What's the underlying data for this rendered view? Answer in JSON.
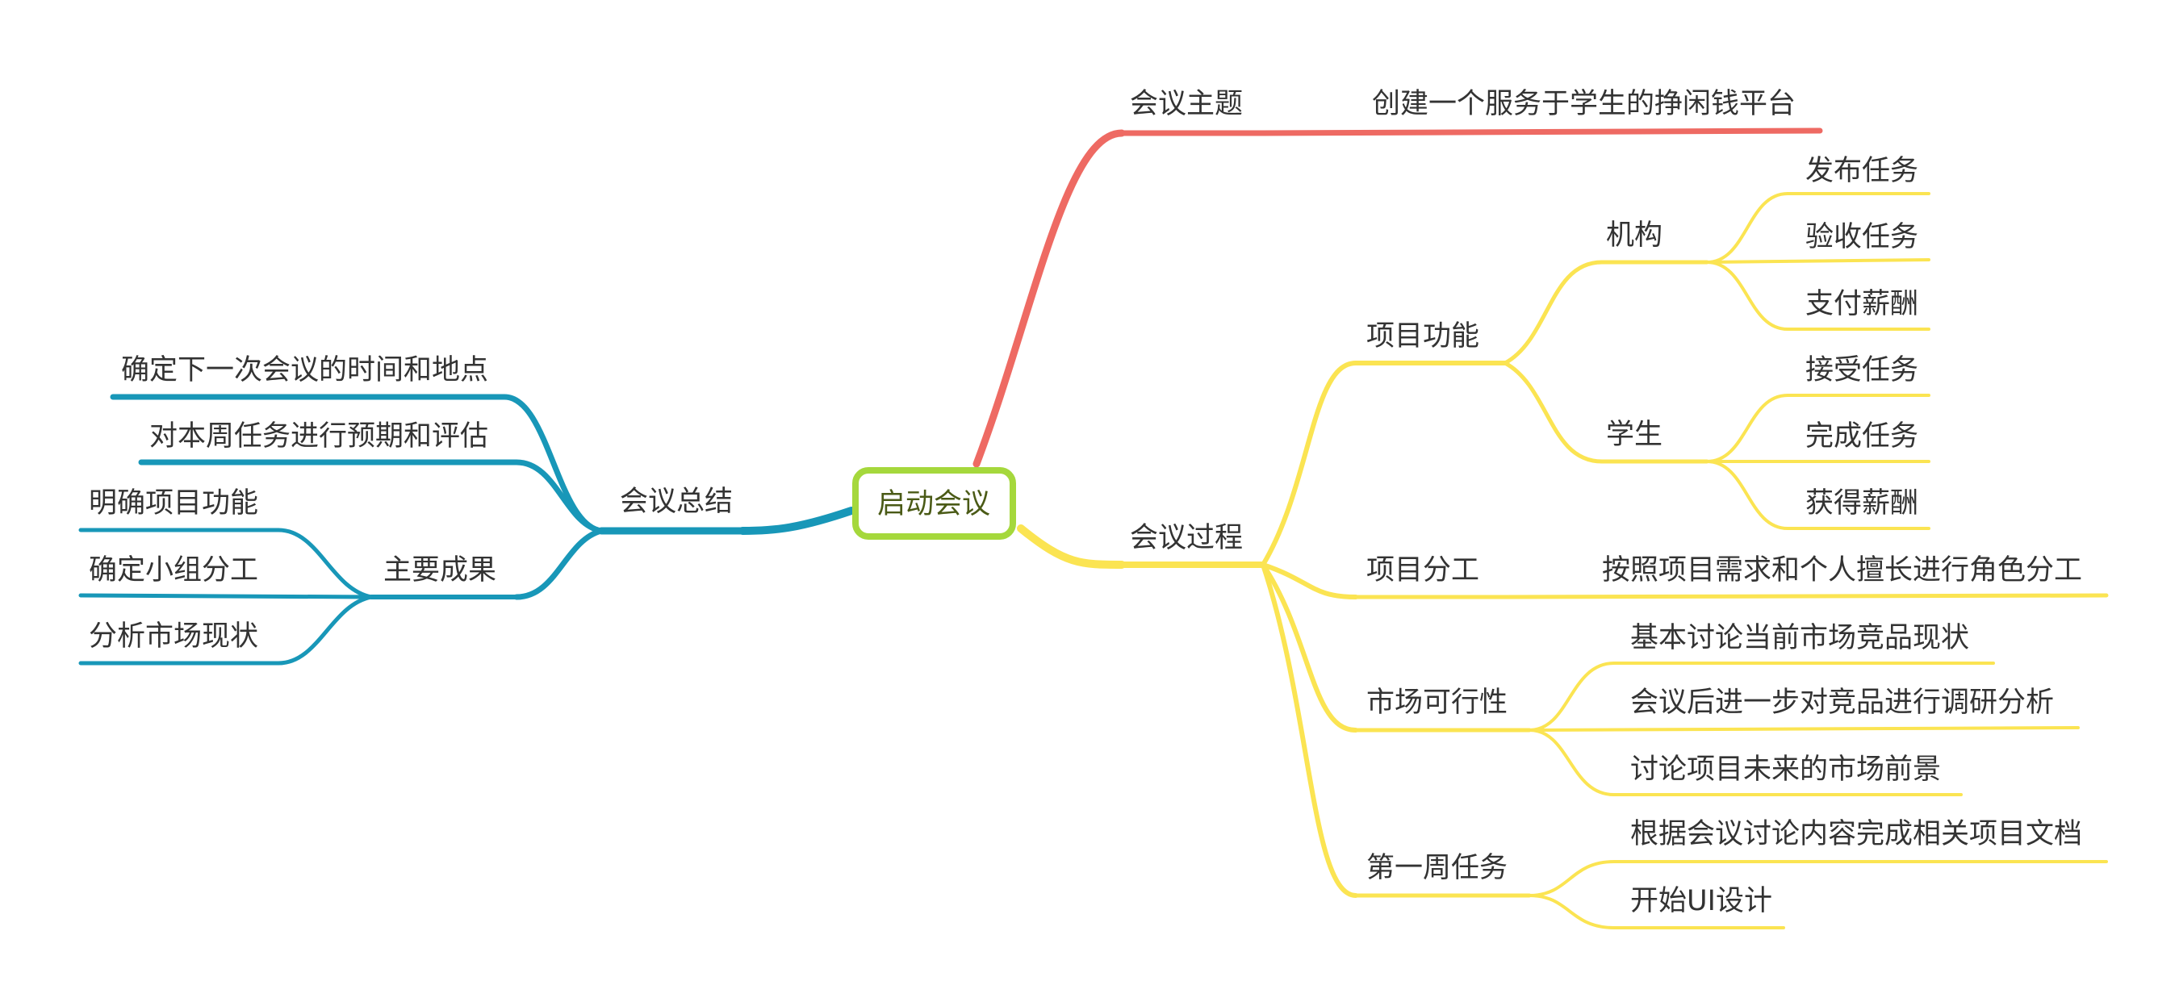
{
  "colors": {
    "topic_branch": "#ee6a63",
    "process_branch": "#fbe452",
    "summary_branch": "#1897b8",
    "root_border": "#a5d83c",
    "root_text": "#4a5a16",
    "text": "#333333"
  },
  "root": {
    "label": "启动会议"
  },
  "topic": {
    "label": "会议主题",
    "detail": "创建一个服务于学生的挣闲钱平台"
  },
  "process": {
    "label": "会议过程",
    "features": {
      "label": "项目功能",
      "org": {
        "label": "机构",
        "items": [
          "发布任务",
          "验收任务",
          "支付薪酬"
        ]
      },
      "student": {
        "label": "学生",
        "items": [
          "接受任务",
          "完成任务",
          "获得薪酬"
        ]
      }
    },
    "division": {
      "label": "项目分工",
      "detail": "按照项目需求和个人擅长进行角色分工"
    },
    "market": {
      "label": "市场可行性",
      "items": [
        "基本讨论当前市场竞品现状",
        "会议后进一步对竞品进行调研分析",
        "讨论项目未来的市场前景"
      ]
    },
    "week1": {
      "label": "第一周任务",
      "items": [
        "根据会议讨论内容完成相关项目文档",
        "开始UI设计"
      ]
    }
  },
  "summary": {
    "label": "会议总结",
    "items": [
      "确定下一次会议的时间和地点",
      "对本周任务进行预期和评估"
    ],
    "outcomes": {
      "label": "主要成果",
      "items": [
        "明确项目功能",
        "确定小组分工",
        "分析市场现状"
      ]
    }
  }
}
